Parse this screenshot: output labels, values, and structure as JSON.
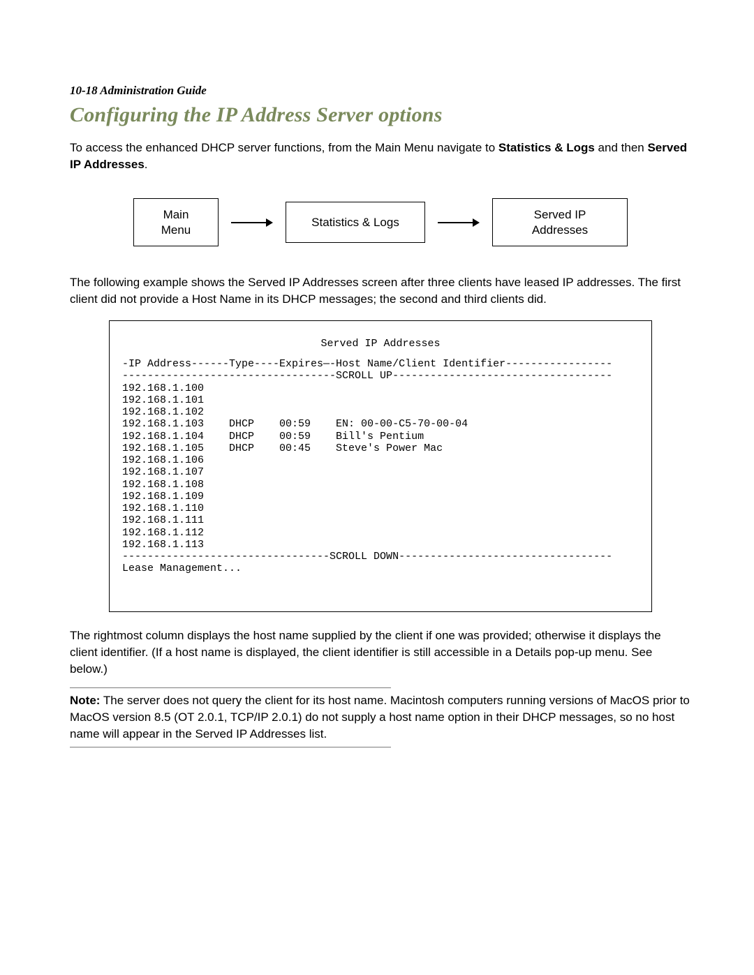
{
  "page_header": "10-18  Administration Guide",
  "section_title": "Configuring the IP Address Server options",
  "intro": {
    "pre": "To access the enhanced DHCP server functions, from the Main Menu navigate to ",
    "bold1": "Statistics & Logs",
    "mid": " and then ",
    "bold2": "Served IP Addresses",
    "post": "."
  },
  "nav": {
    "box1": "Main\nMenu",
    "box2": "Statistics & Logs",
    "box3": "Served IP\nAddresses"
  },
  "after_nav": "The following example shows the Served IP Addresses screen after three clients have leased IP addresses. The first client did not provide a Host Name in its DHCP messages; the second and third clients did.",
  "terminal": {
    "title": "Served IP Addresses",
    "header_line": "-IP Address------Type----Expires—-Host Name/Client Identifier-----------------",
    "scroll_up": "----------------------------------SCROLL UP-----------------------------------",
    "rows": [
      {
        "ip": "192.168.1.100"
      },
      {
        "ip": "192.168.1.101"
      },
      {
        "ip": "192.168.1.102"
      },
      {
        "ip": "192.168.1.103",
        "type": "DHCP",
        "expires": "00:59",
        "host": "EN: 00-00-C5-70-00-04"
      },
      {
        "ip": "192.168.1.104",
        "type": "DHCP",
        "expires": "00:59",
        "host": "Bill's Pentium"
      },
      {
        "ip": "192.168.1.105",
        "type": "DHCP",
        "expires": "00:45",
        "host": "Steve's Power Mac"
      },
      {
        "ip": "192.168.1.106"
      },
      {
        "ip": "192.168.1.107"
      },
      {
        "ip": "192.168.1.108"
      },
      {
        "ip": "192.168.1.109"
      },
      {
        "ip": "192.168.1.110"
      },
      {
        "ip": "192.168.1.111"
      },
      {
        "ip": "192.168.1.112"
      },
      {
        "ip": "192.168.1.113"
      }
    ],
    "scroll_down": "---------------------------------SCROLL DOWN----------------------------------",
    "footer": "Lease Management..."
  },
  "after_terminal": "The rightmost column displays the host name supplied by the client if one was provided; otherwise it displays the client identifier. (If a host name is displayed, the client identifier is still accessible in a Details pop-up menu. See below.)",
  "note": {
    "label": "Note:",
    "body": "  The server does not query the client for its host name. Macintosh computers running versions of MacOS prior to MacOS version 8.5 (OT 2.0.1, TCP/IP 2.0.1) do not supply a host name option in their DHCP messages, so no host name will appear in the Served IP Addresses list."
  }
}
